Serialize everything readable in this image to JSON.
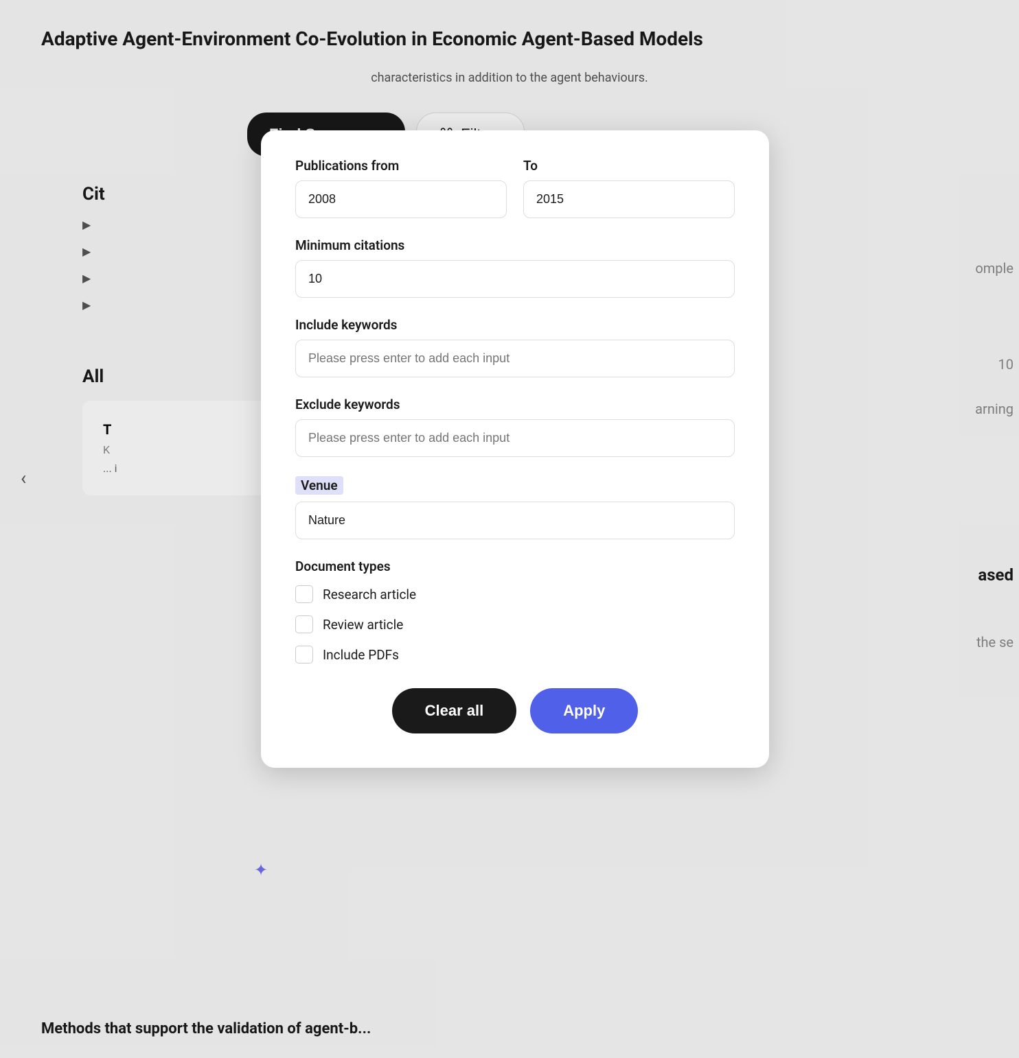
{
  "page": {
    "title": "Adaptive Agent-Environment Co-Evolution in Economic Agent-Based Models",
    "description": "characteristics in addition to the agent behaviours."
  },
  "toolbar": {
    "find_sources_label": "Find Sources",
    "find_sources_enter": "↵",
    "filters_label": "Filters",
    "filters_icon": "⌘"
  },
  "citations_section": {
    "label": "Cit"
  },
  "right_partial": {
    "omple": "omple",
    "num_10": "10",
    "arning": "arning",
    "ased": "ased",
    "the_se": "the se"
  },
  "all_section": {
    "label": "All"
  },
  "bottom_text": "Methods that support the validation of agent-b...",
  "filter_panel": {
    "publications_from_label": "Publications from",
    "publications_to_label": "To",
    "publications_from_value": "2008",
    "publications_to_value": "2015",
    "min_citations_label": "Minimum citations",
    "min_citations_value": "10",
    "include_keywords_label": "Include keywords",
    "include_keywords_placeholder": "Please press enter to add each input",
    "exclude_keywords_label": "Exclude keywords",
    "exclude_keywords_placeholder": "Please press enter to add each input",
    "venue_label": "Venue",
    "venue_value": "Nature",
    "document_types_label": "Document types",
    "document_types": [
      {
        "id": "research",
        "label": "Research article",
        "checked": false
      },
      {
        "id": "review",
        "label": "Review article",
        "checked": false
      },
      {
        "id": "pdfs",
        "label": "Include PDFs",
        "checked": false
      }
    ],
    "clear_all_label": "Clear all",
    "apply_label": "Apply"
  },
  "back_arrow": "‹"
}
